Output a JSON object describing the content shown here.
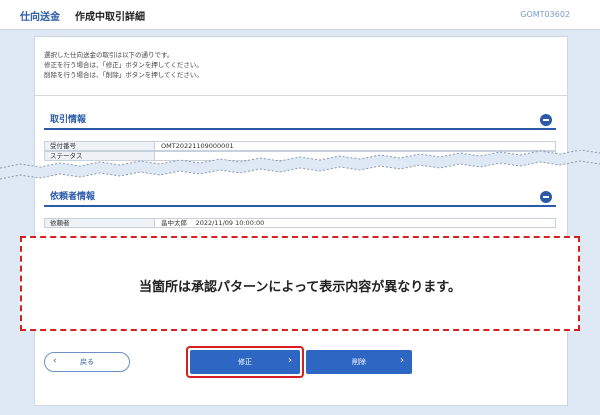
{
  "header": {
    "section": "仕向送金",
    "title": "作成中取引詳細",
    "screen_code": "GOMT03602"
  },
  "intro": {
    "lines": [
      "選択した仕向送金の取引は以下の通りです。",
      "修正を行う場合は、「修正」ボタンを押してください。",
      "削除を行う場合は、「削除」ボタンを押してください。"
    ]
  },
  "torihiki": {
    "title": "取引情報",
    "rows": [
      {
        "label": "受付番号",
        "value": "OMT20221109000001"
      },
      {
        "label": "ステータス",
        "value": ""
      }
    ]
  },
  "irai": {
    "title": "依頼者情報",
    "rows": [
      {
        "label": "依頼者",
        "value": "畠中太郎　 2022/11/09 10:00:00"
      }
    ]
  },
  "notice": {
    "text": "当箇所は承認パターンによって表示内容が異なります。"
  },
  "buttons": {
    "back": "戻る",
    "fix": "修正",
    "delete": "削除"
  },
  "colors": {
    "accent": "#2a5aa8",
    "button": "#2e66c4",
    "highlight": "#d62020",
    "background": "#dfe8f5"
  }
}
